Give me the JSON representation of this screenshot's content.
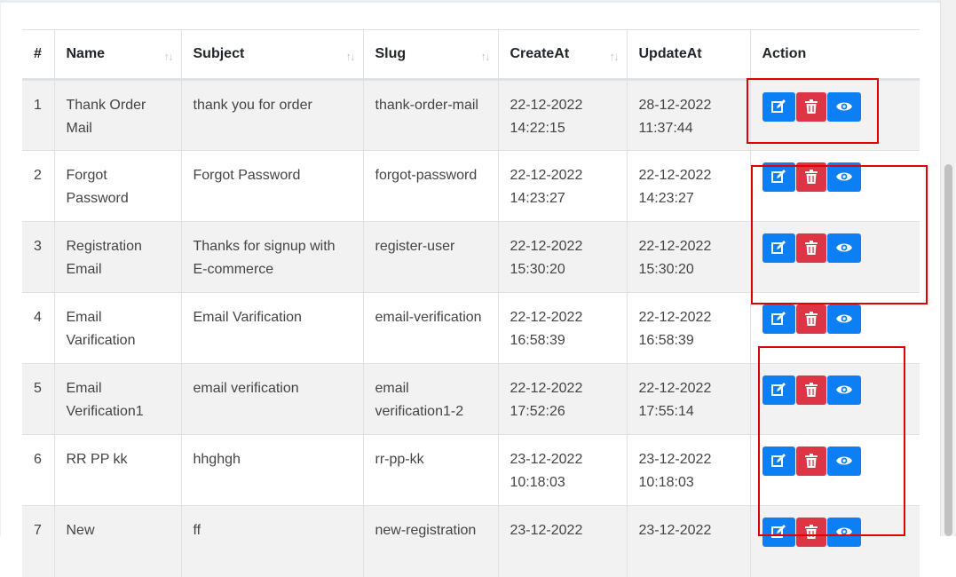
{
  "table": {
    "headers": [
      "#",
      "Name",
      "Subject",
      "Slug",
      "CreateAt",
      "UpdateAt",
      "Action"
    ],
    "rows": [
      {
        "num": "1",
        "name": "Thank Order Mail",
        "subject": "thank you for order",
        "slug": "thank-order-mail",
        "create_date": "22-12-2022",
        "create_time": "14:22:15",
        "update_date": "28-12-2022",
        "update_time": "11:37:44"
      },
      {
        "num": "2",
        "name": "Forgot Password",
        "subject": "Forgot Password",
        "slug": "forgot-password",
        "create_date": "22-12-2022",
        "create_time": "14:23:27",
        "update_date": "22-12-2022",
        "update_time": "14:23:27"
      },
      {
        "num": "3",
        "name": "Registration Email",
        "subject": "Thanks for signup with E-commerce",
        "slug": "register-user",
        "create_date": "22-12-2022",
        "create_time": "15:30:20",
        "update_date": "22-12-2022",
        "update_time": "15:30:20"
      },
      {
        "num": "4",
        "name": "Email Varification",
        "subject": "Email Varification",
        "slug": "email-verification",
        "create_date": "22-12-2022",
        "create_time": "16:58:39",
        "update_date": "22-12-2022",
        "update_time": "16:58:39"
      },
      {
        "num": "5",
        "name": "Email Verification1",
        "subject": "email verification",
        "slug": "email verification1-2",
        "create_date": "22-12-2022",
        "create_time": "17:52:26",
        "update_date": "22-12-2022",
        "update_time": "17:55:14"
      },
      {
        "num": "6",
        "name": "RR PP kk",
        "subject": "hhghgh",
        "slug": "rr-pp-kk",
        "create_date": "23-12-2022",
        "create_time": "10:18:03",
        "update_date": "23-12-2022",
        "update_time": "10:18:03"
      },
      {
        "num": "7",
        "name": "New",
        "subject": "ff",
        "slug": "new-registration",
        "create_date": "23-12-2022",
        "create_time": "",
        "update_date": "23-12-2022",
        "update_time": ""
      }
    ]
  },
  "icons": {
    "edit": "edit-icon",
    "delete": "trash-icon",
    "view": "eye-icon",
    "sort": "sort-arrows-icon"
  },
  "colors": {
    "primary": "#0d7ff5",
    "danger": "#dc3545",
    "annotation": "#e00000"
  }
}
